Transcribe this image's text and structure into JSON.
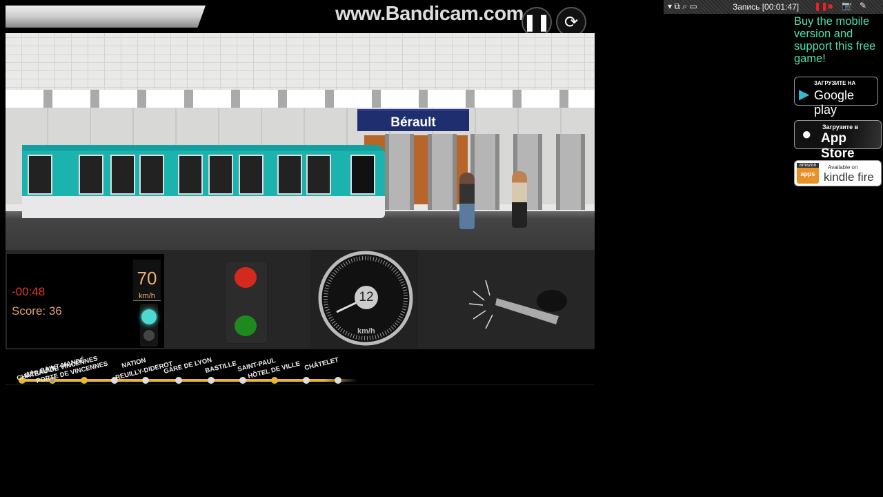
{
  "recorder": {
    "watermark": "www.Bandicam.com",
    "status": "Запись [00:01:47]"
  },
  "controls": {
    "pause_icon": "pause-icon",
    "restart_icon": "restart-icon"
  },
  "station": {
    "sign": "Bérault"
  },
  "hud": {
    "timer": "-00:48",
    "score": "Score: 36",
    "speed_limit": "70",
    "speed_limit_unit": "km/h",
    "speed": "12",
    "speed_unit": "km/h",
    "door_lamp_color": "#4fd8d0"
  },
  "signal": {
    "top_color": "#d42a1e",
    "bottom_color": "#1e8a1e"
  },
  "line": {
    "color": "#e8b830",
    "stations": [
      {
        "name": "CHÂTEAU DE VINCENNES",
        "state": "passed"
      },
      {
        "name": "BÉRAULT",
        "state": "current"
      },
      {
        "name": "SAINT-MANDÉ",
        "state": "stop"
      },
      {
        "name": "PORTE DE VINCENNES",
        "state": "next"
      },
      {
        "name": "NATION",
        "state": "next"
      },
      {
        "name": "REUILLY-DIDEROT",
        "state": "next"
      },
      {
        "name": "GARE DE LYON",
        "state": "next"
      },
      {
        "name": "BASTILLE",
        "state": "next"
      },
      {
        "name": "SAINT-PAUL",
        "state": "stop"
      },
      {
        "name": "HÔTEL DE VILLE",
        "state": "next"
      },
      {
        "name": "CHÂTELET",
        "state": "next"
      }
    ]
  },
  "promo": {
    "text": "Buy the mobile version and support this free game!",
    "google": {
      "top": "ЗАГРУЗИТЕ НА",
      "main": "Google play"
    },
    "apple": {
      "top": "Загрузите в",
      "main": "App Store"
    },
    "kindle": {
      "badge_top": "amazon",
      "badge_bottom": "apps",
      "top": "Available on",
      "main": "kindle fire"
    }
  }
}
